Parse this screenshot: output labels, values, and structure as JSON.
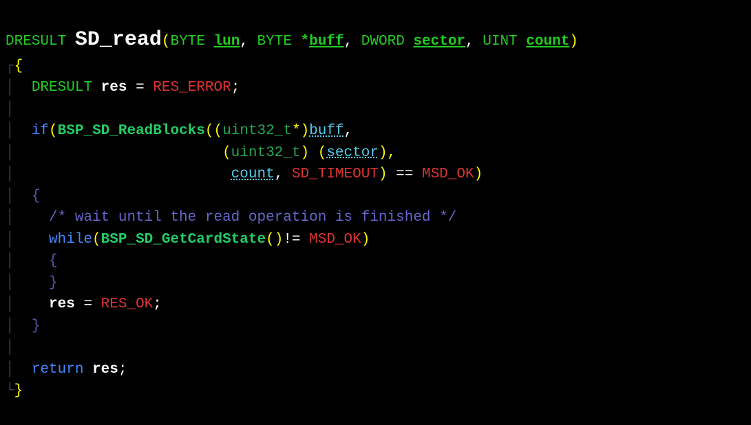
{
  "line1": {
    "ret": "DRESULT ",
    "fn": "SD_read",
    "p1t": "BYTE ",
    "p1": "lun",
    "sep1": ", ",
    "p2t": "BYTE ",
    "star": "*",
    "p2": "buff",
    "sep2": ", ",
    "p3t": "DWORD ",
    "p3": "sector",
    "sep3": ", ",
    "p4t": "UINT ",
    "p4": "count"
  },
  "line3": {
    "indent": "  ",
    "type": "DRESULT ",
    "var": "res",
    "eq": " = ",
    "val": "RES_ERROR",
    "semi": ";"
  },
  "line5": {
    "indent": "  ",
    "kw": "if",
    "call": "BSP_SD_ReadBlocks",
    "cast": "uint32_t",
    "star": "*",
    "arg": "buff",
    "comma": ","
  },
  "line6": {
    "indent": "                        ",
    "lp": "(",
    "cast": "uint32_t",
    "rp": ") (",
    "arg": "sector",
    "tail": "),"
  },
  "line7": {
    "indent": "                         ",
    "arg1": "count",
    "sep": ", ",
    "arg2": "SD_TIMEOUT",
    "rp": ")",
    "eq": " == ",
    "val": "MSD_OK",
    "close": ")"
  },
  "line9": {
    "indent": "    ",
    "text": "/* wait until the read operation is finished */"
  },
  "line10": {
    "indent": "    ",
    "kw": "while",
    "call": "BSP_SD_GetCardState",
    "parens": "()",
    "neq": "!= ",
    "val": "MSD_OK",
    "close": ")"
  },
  "line13": {
    "indent": "    ",
    "var": "res",
    "eq": " = ",
    "val": "RES_OK",
    "semi": ";"
  },
  "line16": {
    "indent": "  ",
    "kw": "return",
    "sp": " ",
    "var": "res",
    "semi": ";"
  },
  "braces": {
    "open": "{",
    "close": "}",
    "lparen": "(",
    "rparen": ")"
  },
  "indent2": "  ",
  "indent4": "    ",
  "guide": "│"
}
